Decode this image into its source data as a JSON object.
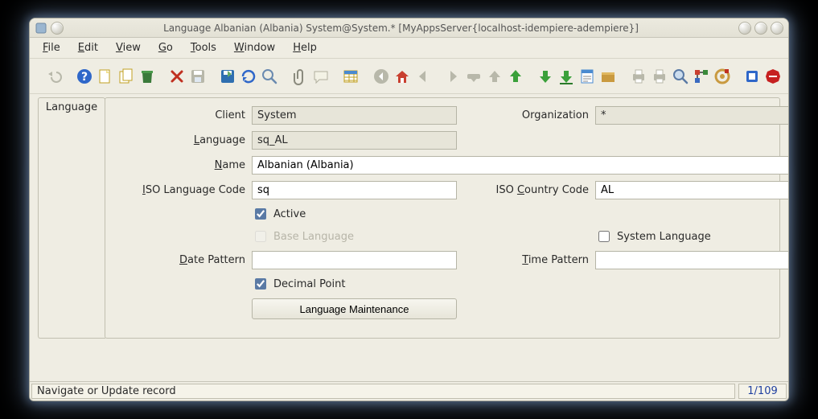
{
  "window": {
    "title": "Language  Albanian (Albania)  System@System.* [MyAppsServer{localhost-idempiere-adempiere}]"
  },
  "menu": {
    "file": "File",
    "edit": "Edit",
    "view": "View",
    "go": "Go",
    "tools": "Tools",
    "window": "Window",
    "help": "Help"
  },
  "tab": {
    "language": "Language"
  },
  "labels": {
    "client": "Client",
    "organization": "Organization",
    "language": "Language",
    "name": "Name",
    "iso_lang": "ISO Language Code",
    "iso_ctry": "ISO Country Code",
    "active": "Active",
    "base_language": "Base Language",
    "system_language": "System Language",
    "date_pattern": "Date Pattern",
    "time_pattern": "Time Pattern",
    "decimal_point": "Decimal Point",
    "language_maintenance": "Language Maintenance"
  },
  "values": {
    "client": "System",
    "organization": "*",
    "language": "sq_AL",
    "name": "Albanian (Albania)",
    "iso_lang": "sq",
    "iso_ctry": "AL",
    "active": true,
    "base_language": false,
    "system_language": false,
    "date_pattern": "",
    "time_pattern": "",
    "decimal_point": true
  },
  "status": {
    "message": "Navigate or Update record",
    "position": "1/109"
  },
  "toolbar_icons": [
    "undo",
    "help",
    "new",
    "copy",
    "trash",
    "delete-x",
    "save",
    "refresh",
    "requery",
    "find",
    "attach",
    "chat",
    "grid",
    "back",
    "home",
    "prev",
    "next",
    "last",
    "up",
    "arrow-up",
    "arrow-down",
    "down",
    "report",
    "archive",
    "print-all",
    "print",
    "zoom",
    "workflow",
    "process",
    "product",
    "exit"
  ],
  "toolbar_enabled": {
    "undo": false,
    "save": false,
    "back": false,
    "prev": false,
    "next": false,
    "last": false,
    "up": false,
    "print-all": false,
    "print": false
  },
  "colors": {
    "bg": "#efede3",
    "selected": "#cfe0f3",
    "link": "#2040a0"
  }
}
